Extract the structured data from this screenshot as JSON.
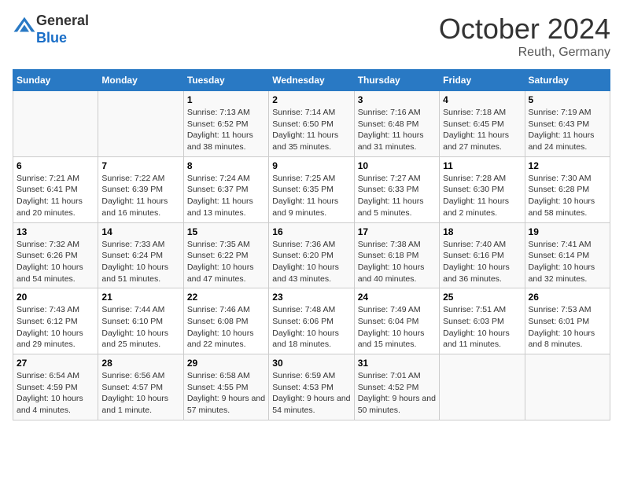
{
  "header": {
    "logo_general": "General",
    "logo_blue": "Blue",
    "month_title": "October 2024",
    "location": "Reuth, Germany"
  },
  "days_of_week": [
    "Sunday",
    "Monday",
    "Tuesday",
    "Wednesday",
    "Thursday",
    "Friday",
    "Saturday"
  ],
  "weeks": [
    [
      null,
      null,
      {
        "day": 1,
        "sunrise": "7:13 AM",
        "sunset": "6:52 PM",
        "daylight": "11 hours and 38 minutes."
      },
      {
        "day": 2,
        "sunrise": "7:14 AM",
        "sunset": "6:50 PM",
        "daylight": "11 hours and 35 minutes."
      },
      {
        "day": 3,
        "sunrise": "7:16 AM",
        "sunset": "6:48 PM",
        "daylight": "11 hours and 31 minutes."
      },
      {
        "day": 4,
        "sunrise": "7:18 AM",
        "sunset": "6:45 PM",
        "daylight": "11 hours and 27 minutes."
      },
      {
        "day": 5,
        "sunrise": "7:19 AM",
        "sunset": "6:43 PM",
        "daylight": "11 hours and 24 minutes."
      }
    ],
    [
      {
        "day": 6,
        "sunrise": "7:21 AM",
        "sunset": "6:41 PM",
        "daylight": "11 hours and 20 minutes."
      },
      {
        "day": 7,
        "sunrise": "7:22 AM",
        "sunset": "6:39 PM",
        "daylight": "11 hours and 16 minutes."
      },
      {
        "day": 8,
        "sunrise": "7:24 AM",
        "sunset": "6:37 PM",
        "daylight": "11 hours and 13 minutes."
      },
      {
        "day": 9,
        "sunrise": "7:25 AM",
        "sunset": "6:35 PM",
        "daylight": "11 hours and 9 minutes."
      },
      {
        "day": 10,
        "sunrise": "7:27 AM",
        "sunset": "6:33 PM",
        "daylight": "11 hours and 5 minutes."
      },
      {
        "day": 11,
        "sunrise": "7:28 AM",
        "sunset": "6:30 PM",
        "daylight": "11 hours and 2 minutes."
      },
      {
        "day": 12,
        "sunrise": "7:30 AM",
        "sunset": "6:28 PM",
        "daylight": "10 hours and 58 minutes."
      }
    ],
    [
      {
        "day": 13,
        "sunrise": "7:32 AM",
        "sunset": "6:26 PM",
        "daylight": "10 hours and 54 minutes."
      },
      {
        "day": 14,
        "sunrise": "7:33 AM",
        "sunset": "6:24 PM",
        "daylight": "10 hours and 51 minutes."
      },
      {
        "day": 15,
        "sunrise": "7:35 AM",
        "sunset": "6:22 PM",
        "daylight": "10 hours and 47 minutes."
      },
      {
        "day": 16,
        "sunrise": "7:36 AM",
        "sunset": "6:20 PM",
        "daylight": "10 hours and 43 minutes."
      },
      {
        "day": 17,
        "sunrise": "7:38 AM",
        "sunset": "6:18 PM",
        "daylight": "10 hours and 40 minutes."
      },
      {
        "day": 18,
        "sunrise": "7:40 AM",
        "sunset": "6:16 PM",
        "daylight": "10 hours and 36 minutes."
      },
      {
        "day": 19,
        "sunrise": "7:41 AM",
        "sunset": "6:14 PM",
        "daylight": "10 hours and 32 minutes."
      }
    ],
    [
      {
        "day": 20,
        "sunrise": "7:43 AM",
        "sunset": "6:12 PM",
        "daylight": "10 hours and 29 minutes."
      },
      {
        "day": 21,
        "sunrise": "7:44 AM",
        "sunset": "6:10 PM",
        "daylight": "10 hours and 25 minutes."
      },
      {
        "day": 22,
        "sunrise": "7:46 AM",
        "sunset": "6:08 PM",
        "daylight": "10 hours and 22 minutes."
      },
      {
        "day": 23,
        "sunrise": "7:48 AM",
        "sunset": "6:06 PM",
        "daylight": "10 hours and 18 minutes."
      },
      {
        "day": 24,
        "sunrise": "7:49 AM",
        "sunset": "6:04 PM",
        "daylight": "10 hours and 15 minutes."
      },
      {
        "day": 25,
        "sunrise": "7:51 AM",
        "sunset": "6:03 PM",
        "daylight": "10 hours and 11 minutes."
      },
      {
        "day": 26,
        "sunrise": "7:53 AM",
        "sunset": "6:01 PM",
        "daylight": "10 hours and 8 minutes."
      }
    ],
    [
      {
        "day": 27,
        "sunrise": "6:54 AM",
        "sunset": "4:59 PM",
        "daylight": "10 hours and 4 minutes."
      },
      {
        "day": 28,
        "sunrise": "6:56 AM",
        "sunset": "4:57 PM",
        "daylight": "10 hours and 1 minute."
      },
      {
        "day": 29,
        "sunrise": "6:58 AM",
        "sunset": "4:55 PM",
        "daylight": "9 hours and 57 minutes."
      },
      {
        "day": 30,
        "sunrise": "6:59 AM",
        "sunset": "4:53 PM",
        "daylight": "9 hours and 54 minutes."
      },
      {
        "day": 31,
        "sunrise": "7:01 AM",
        "sunset": "4:52 PM",
        "daylight": "9 hours and 50 minutes."
      },
      null,
      null
    ]
  ],
  "labels": {
    "sunrise": "Sunrise:",
    "sunset": "Sunset:",
    "daylight": "Daylight:"
  }
}
